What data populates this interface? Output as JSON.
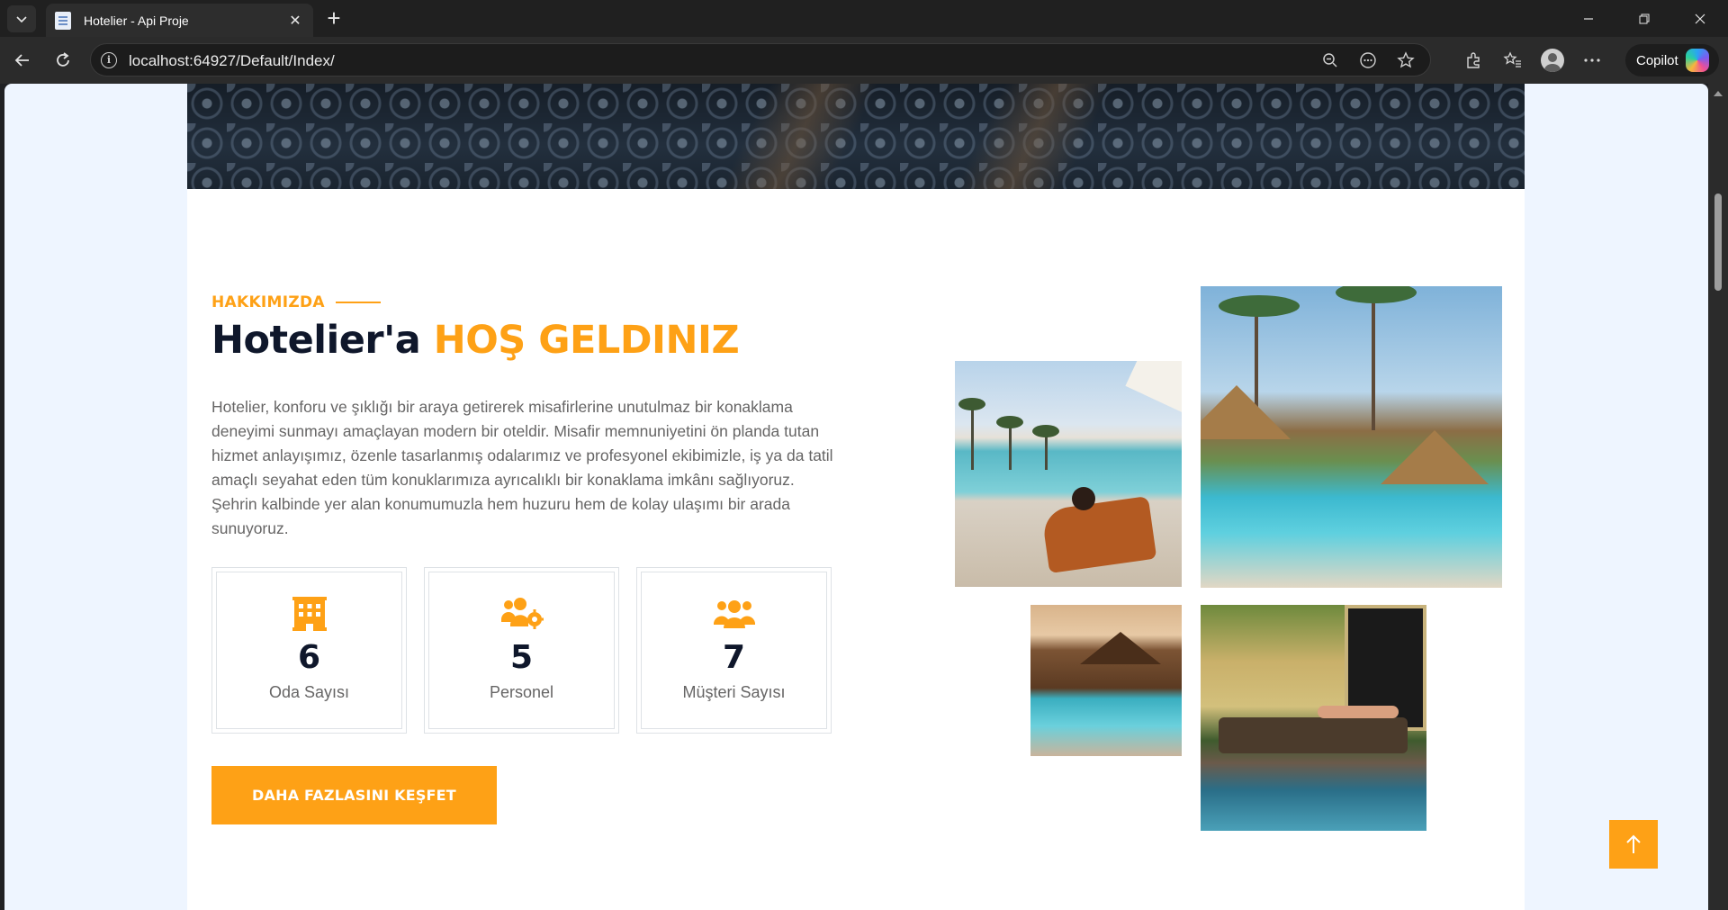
{
  "browser": {
    "tab_title": "Hotelier - Api Proje",
    "url": "localhost:64927/Default/Index/",
    "copilot_label": "Copilot"
  },
  "about": {
    "eyebrow": "HAKKIMIZDA",
    "heading_main": "Hotelier'a",
    "heading_accent": "HOŞ GELDINIZ",
    "paragraph": "Hotelier, konforu ve şıklığı bir araya getirerek misafirlerine unutulmaz bir konaklama deneyimi sunmayı amaçlayan modern bir oteldir. Misafir memnuniyetini ön planda tutan hizmet anlayışımız, özenle tasarlanmış odalarımız ve profesyonel ekibimizle, iş ya da tatil amaçlı seyahat eden tüm konuklarımıza ayrıcalıklı bir konaklama imkânı sağlıyoruz. Şehrin kalbinde yer alan konumumuzla hem huzuru hem de kolay ulaşımı bir arada sunuyoruz.",
    "stats": [
      {
        "icon": "hotel-icon",
        "value": "6",
        "label": "Oda Sayısı"
      },
      {
        "icon": "users-cog-icon",
        "value": "5",
        "label": "Personel"
      },
      {
        "icon": "users-icon",
        "value": "7",
        "label": "Müşteri Sayısı"
      }
    ],
    "cta_label": "DAHA FAZLASINI KEŞFET"
  },
  "colors": {
    "primary": "#fea116",
    "dark": "#0f172b",
    "text": "#666565",
    "page_bg": "#eef5ff"
  }
}
